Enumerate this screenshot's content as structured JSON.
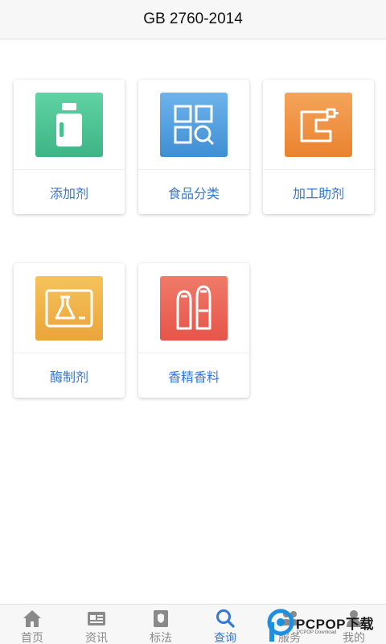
{
  "header": {
    "title": "GB 2760-2014"
  },
  "categories": [
    {
      "label": "添加剂",
      "icon": "bottle-icon",
      "color_top": "#5fd3a4",
      "color_bottom": "#3fb486"
    },
    {
      "label": "食品分类",
      "icon": "grid-search-icon",
      "color_top": "#6db3ec",
      "color_bottom": "#3f8fd3"
    },
    {
      "label": "加工助剂",
      "icon": "machine-icon",
      "color_top": "#f4a45a",
      "color_bottom": "#ea8330"
    },
    {
      "label": "酶制剂",
      "icon": "flask-monitor-icon",
      "color_top": "#f5c35b",
      "color_bottom": "#eba43a"
    },
    {
      "label": "香精香料",
      "icon": "salt-pepper-icon",
      "color_top": "#f07a68",
      "color_bottom": "#e6554a"
    }
  ],
  "tabs": [
    {
      "label": "首页",
      "icon": "home-icon"
    },
    {
      "label": "资讯",
      "icon": "news-icon"
    },
    {
      "label": "标法",
      "icon": "standards-icon"
    },
    {
      "label": "查询",
      "icon": "search-icon",
      "active": true
    },
    {
      "label": "服务",
      "icon": "service-icon"
    },
    {
      "label": "我的",
      "icon": "profile-icon"
    }
  ],
  "watermark": {
    "brand": "PCPOP下载",
    "sub": "PCPOP Download"
  },
  "colors": {
    "accent": "#3478d6",
    "tab_inactive": "#8a8a8a"
  }
}
